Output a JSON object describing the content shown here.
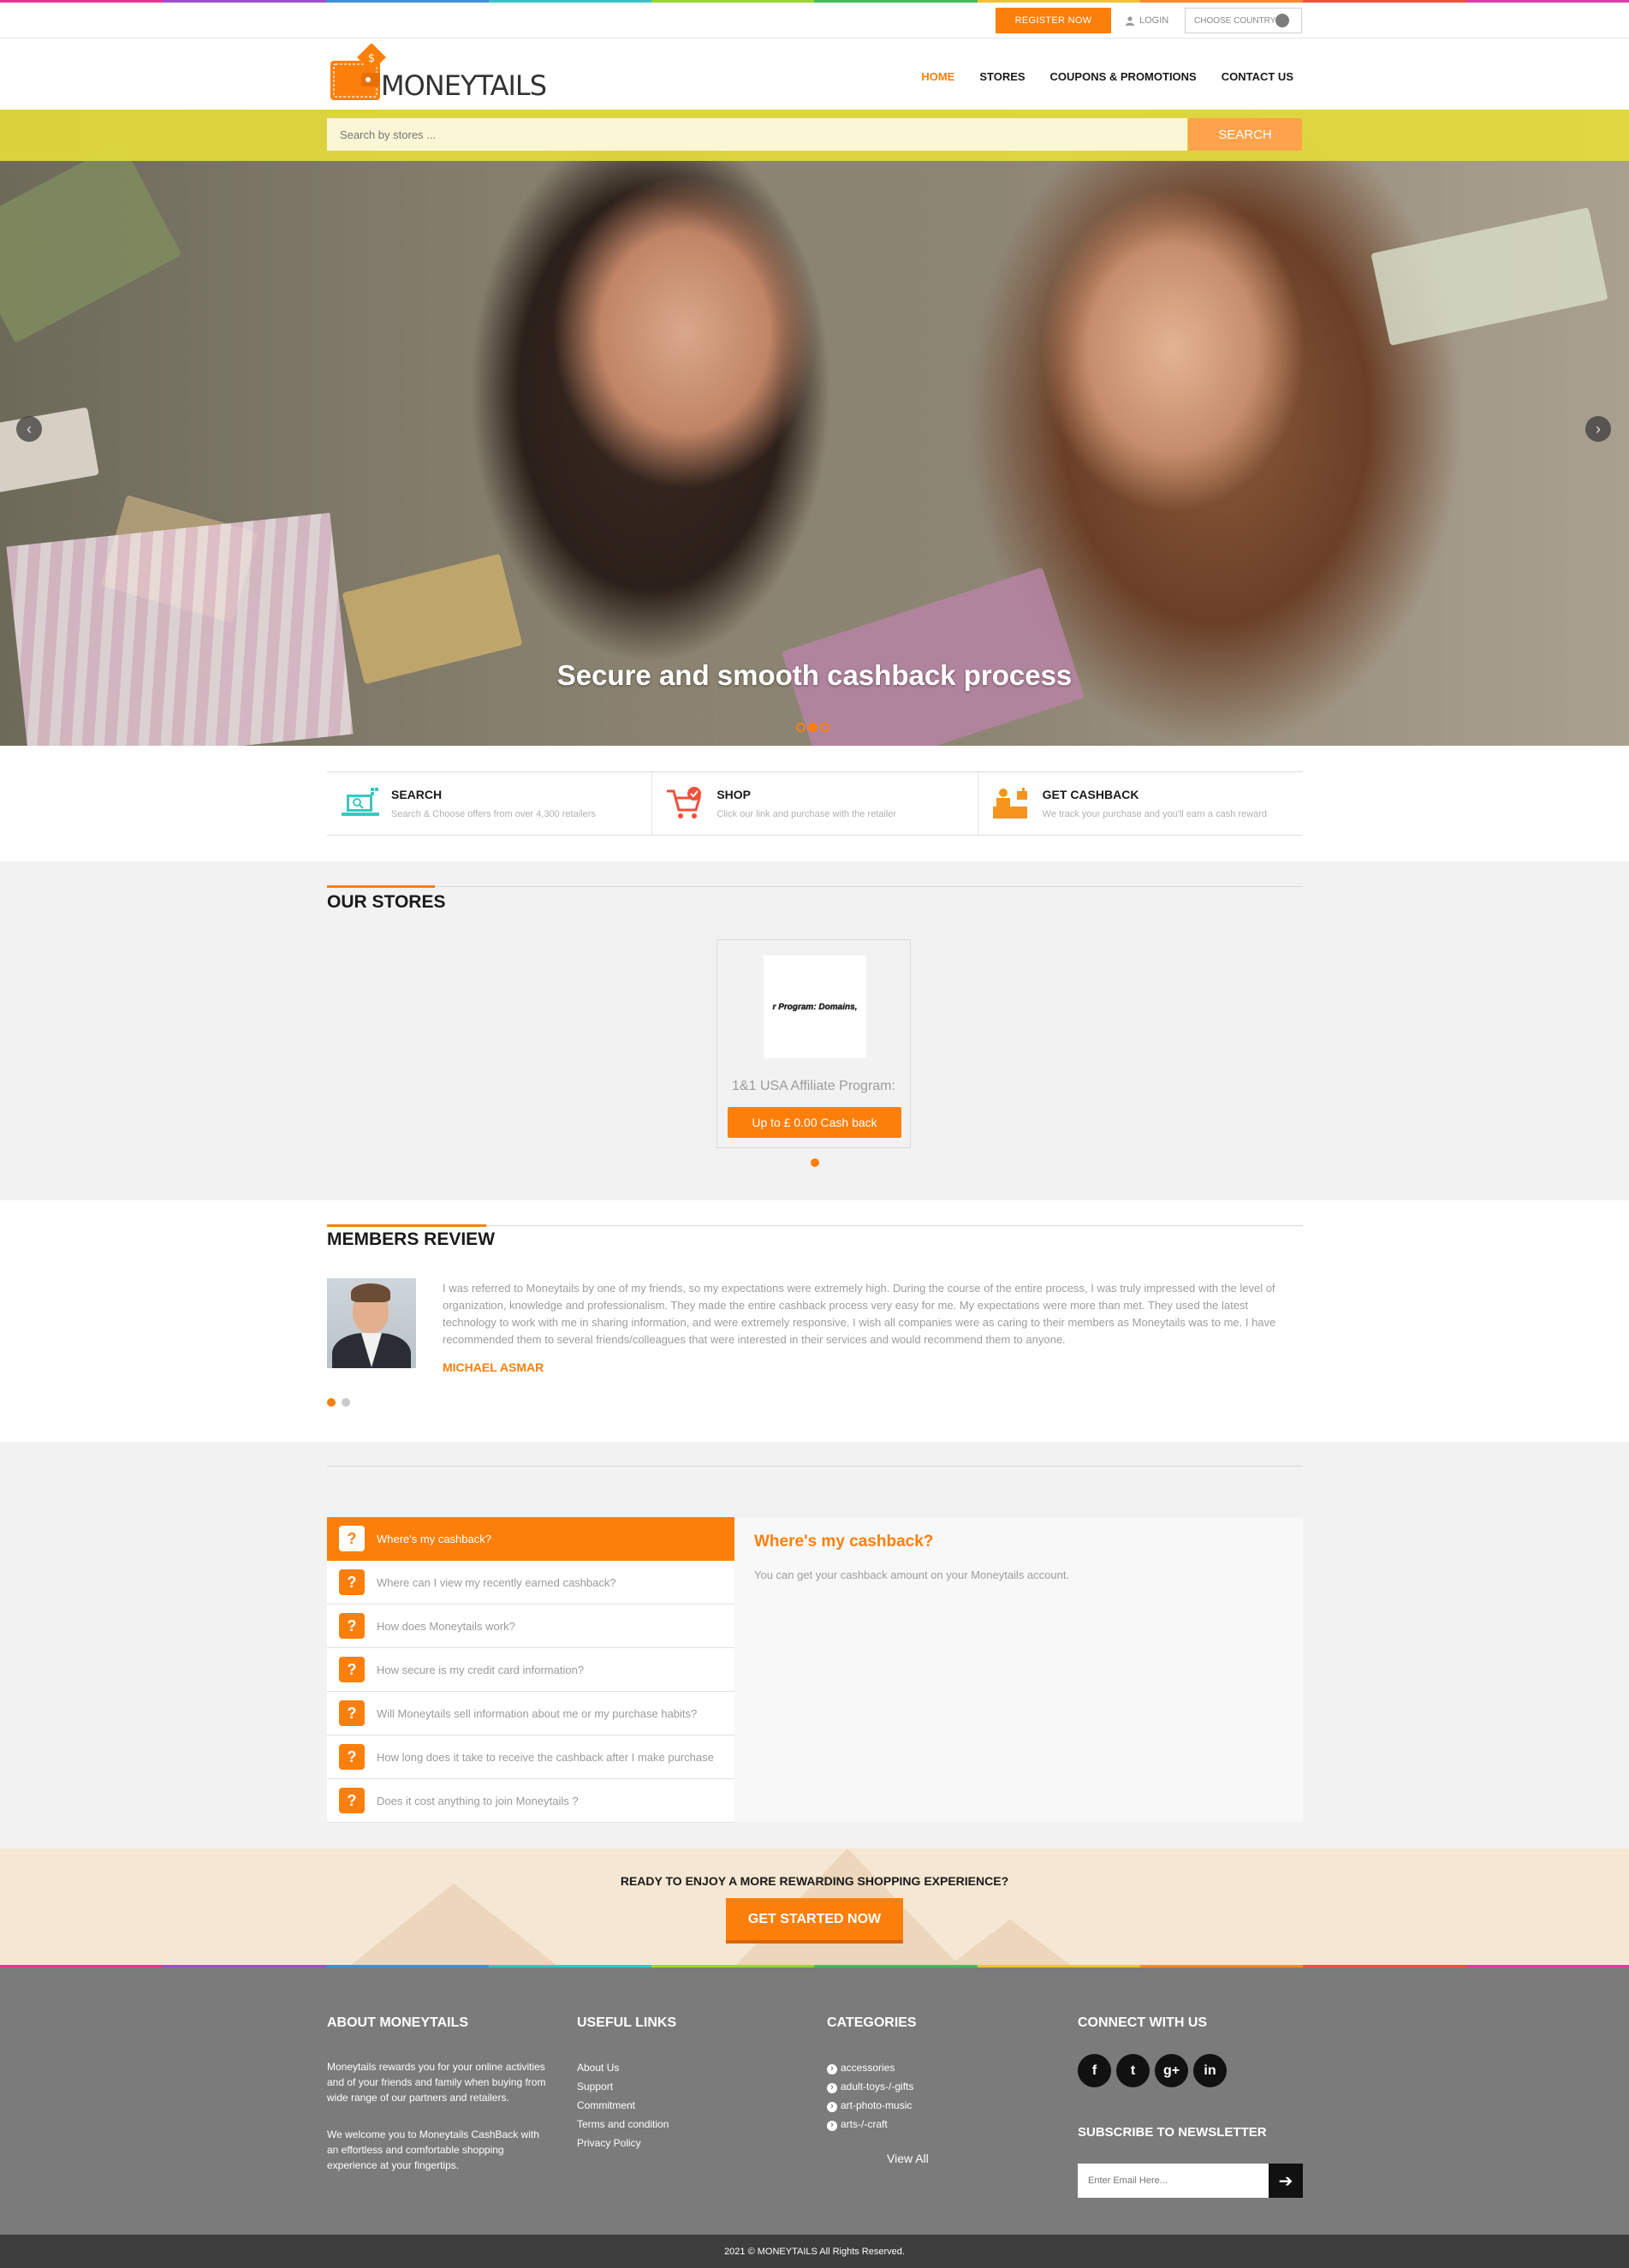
{
  "colors": {
    "accent": "#fd7f0b",
    "search_band": "#e4dc3c",
    "footer_bg": "#7b7b7b",
    "cta_bg": "#f5e7d3",
    "section_bg": "#f3f2f2"
  },
  "rainbow": [
    "#e9348f",
    "#9a50c9",
    "#3f8ed4",
    "#32c6c7",
    "#9ad62f",
    "#43bd5a",
    "#f1c231",
    "#fb8a24",
    "#f04e3e",
    "#e23aa6"
  ],
  "topbar": {
    "register_label": "REGISTER NOW",
    "login_label": "LOGIN",
    "country_label": "CHOOSE COUNTRY"
  },
  "header": {
    "logo_text": "MONEYTAILS",
    "nav": [
      {
        "label": "HOME",
        "active": true
      },
      {
        "label": "STORES",
        "active": false
      },
      {
        "label": "COUPONS & PROMOTIONS",
        "active": false
      },
      {
        "label": "CONTACT US",
        "active": false
      }
    ]
  },
  "search": {
    "placeholder": "Search by stores ...",
    "button_label": "SEARCH"
  },
  "hero": {
    "caption": "Secure and smooth cashback process",
    "slide_count": 3,
    "active_slide": 2
  },
  "steps": [
    {
      "icon": "laptop-search-icon",
      "title": "SEARCH",
      "text": "Search & Choose offers from over 4,300 retailers"
    },
    {
      "icon": "cart-check-icon",
      "title": "SHOP",
      "text": "Click our link and purchase with the retailer"
    },
    {
      "icon": "cashier-icon",
      "title": "GET CASHBACK",
      "text": "We track your purchase and you'll earn a cash reward"
    }
  ],
  "stores": {
    "title": "OUR STORES",
    "items": [
      {
        "logo_text": "r Program: Domains,",
        "name": "1&1 USA Affiliate Program:",
        "button_label": "Up to £ 0.00 Cash back"
      }
    ]
  },
  "review": {
    "title": "MEMBERS REVIEW",
    "text": "I was referred to Moneytails by one of my friends, so my expectations were extremely high. During the course of the entire process, I was truly impressed with the level of organization, knowledge and professionalism. They made the entire cashback process very easy for me. My expectations were more than met. They used the latest technology to work with me in sharing information, and were extremely responsive. I wish all companies were as caring to their members as Moneytails was to me. I have recommended them to several friends/colleagues that were interested in their services and would recommend them to anyone.",
    "name": "MICHAEL ASMAR"
  },
  "faq": {
    "items": [
      "Where's my cashback?",
      "Where can I view my recently earned cashback?",
      "How does Moneytails work?",
      "How secure is my credit card information?",
      "Will Moneytails sell information about me or my purchase habits?",
      "How long does it take to receive the cashback after I make purchase",
      "Does it cost anything to join Moneytails ?"
    ],
    "active_index": 0,
    "answer_title": "Where's my cashback?",
    "answer_text": "You can get your cashback amount on your Moneytails account."
  },
  "cta": {
    "title": "READY TO ENJOY A MORE REWARDING SHOPPING EXPERIENCE?",
    "button_label": "GET STARTED NOW"
  },
  "footer": {
    "about": {
      "title": "ABOUT MONEYTAILS",
      "p1": "Moneytails rewards you for your online activities and of your friends and family when buying from wide range of our partners and retailers.",
      "p2": "We welcome you to Moneytails CashBack with an effortless and comfortable shopping experience at your fingertips."
    },
    "links": {
      "title": "USEFUL LINKS",
      "items": [
        "About Us",
        "Support",
        "Commitment",
        "Terms and condition",
        "Privacy Policy"
      ]
    },
    "categories": {
      "title": "CATEGORIES",
      "items": [
        "accessories",
        "adult-toys-/-gifts",
        "art-photo-music",
        "arts-/-craft"
      ],
      "view_all": "View All"
    },
    "connect": {
      "title": "CONNECT WITH US",
      "social": [
        "f",
        "t",
        "g+",
        "in"
      ]
    },
    "newsletter": {
      "title": "SUBSCRIBE TO NEWSLETTER",
      "placeholder": "Enter Email Here..."
    },
    "copyright": "2021 © MONEYTAILS All Rights Reserved."
  }
}
